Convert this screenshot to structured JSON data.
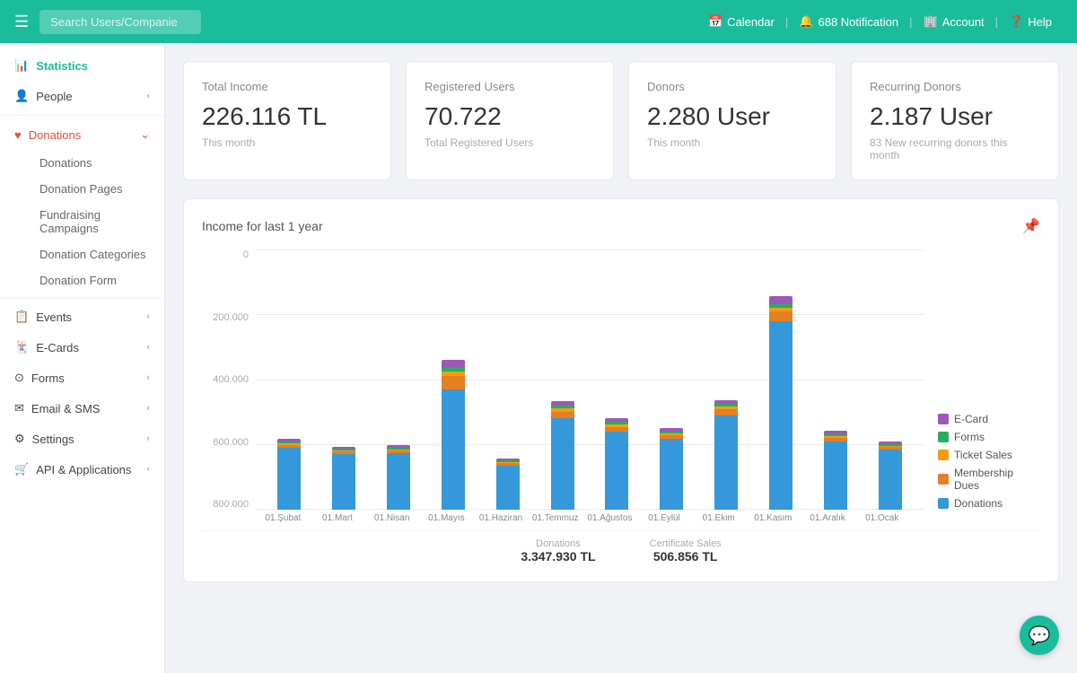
{
  "topnav": {
    "search_placeholder": "Search Users/Companie",
    "calendar_label": "Calendar",
    "notification_label": "688 Notification",
    "account_label": "Account",
    "help_label": "Help"
  },
  "sidebar": {
    "statistics_label": "Statistics",
    "people_label": "People",
    "donations_group_label": "Donations",
    "donations_sub": [
      {
        "label": "Donations"
      },
      {
        "label": "Donation Pages"
      },
      {
        "label": "Fundraising Campaigns"
      },
      {
        "label": "Donation Categories"
      },
      {
        "label": "Donation Form"
      }
    ],
    "events_label": "Events",
    "ecards_label": "E-Cards",
    "forms_label": "Forms",
    "email_sms_label": "Email & SMS",
    "settings_label": "Settings",
    "api_label": "API & Applications"
  },
  "stats": [
    {
      "title": "Total Income",
      "value": "226.116 TL",
      "sub": "This month"
    },
    {
      "title": "Registered Users",
      "value": "70.722",
      "sub": "Total Registered Users"
    },
    {
      "title": "Donors",
      "value": "2.280 User",
      "sub": "This month"
    },
    {
      "title": "Recurring Donors",
      "value": "2.187 User",
      "sub": "83 New recurring donors this month"
    }
  ],
  "chart": {
    "title": "Income for last 1 year",
    "pin_icon": "📌",
    "y_labels": [
      "0",
      "200.000",
      "400.000",
      "600.000",
      "800.000"
    ],
    "x_labels": [
      {
        "top": "01.Şubat",
        "bot": "01.Mart"
      },
      {
        "top": "01.Nisan",
        "bot": "01.Mayıs"
      },
      {
        "top": "01.Haziran",
        "bot": "01.Temmuz"
      },
      {
        "top": "01.Ağustos",
        "bot": "01.Eylül"
      },
      {
        "top": "01.Ekim",
        "bot": "01.Kasım"
      },
      {
        "top": "01.Aralık",
        "bot": "01.Ocak"
      }
    ],
    "legend": [
      {
        "label": "E-Card",
        "color": "#9b59b6"
      },
      {
        "label": "Forms",
        "color": "#27ae60"
      },
      {
        "label": "Ticket Sales",
        "color": "#f39c12"
      },
      {
        "label": "Membership Dues",
        "color": "#e67e22"
      },
      {
        "label": "Donations",
        "color": "#3498db"
      }
    ],
    "bars": [
      {
        "donations": 190,
        "membership": 8,
        "ticket": 5,
        "forms": 6,
        "ecard": 8
      },
      {
        "donations": 170,
        "membership": 7,
        "ticket": 4,
        "forms": 5,
        "ecard": 7
      },
      {
        "donations": 175,
        "membership": 8,
        "ticket": 4,
        "forms": 5,
        "ecard": 7
      },
      {
        "donations": 370,
        "membership": 40,
        "ticket": 15,
        "forms": 10,
        "ecard": 25
      },
      {
        "donations": 135,
        "membership": 8,
        "ticket": 4,
        "forms": 5,
        "ecard": 6
      },
      {
        "donations": 280,
        "membership": 20,
        "ticket": 10,
        "forms": 8,
        "ecard": 15
      },
      {
        "donations": 240,
        "membership": 15,
        "ticket": 8,
        "forms": 7,
        "ecard": 10
      },
      {
        "donations": 220,
        "membership": 12,
        "ticket": 6,
        "forms": 6,
        "ecard": 8
      },
      {
        "donations": 290,
        "membership": 18,
        "ticket": 9,
        "forms": 8,
        "ecard": 12
      },
      {
        "donations": 580,
        "membership": 30,
        "ticket": 12,
        "forms": 10,
        "ecard": 25
      },
      {
        "donations": 210,
        "membership": 12,
        "ticket": 6,
        "forms": 6,
        "ecard": 10
      },
      {
        "donations": 185,
        "membership": 8,
        "ticket": 4,
        "forms": 5,
        "ecard": 7
      }
    ],
    "footer": [
      {
        "label": "Donations",
        "value": "3.347.930 TL"
      },
      {
        "label": "Certificate Sales",
        "value": "506.856 TL"
      }
    ]
  }
}
